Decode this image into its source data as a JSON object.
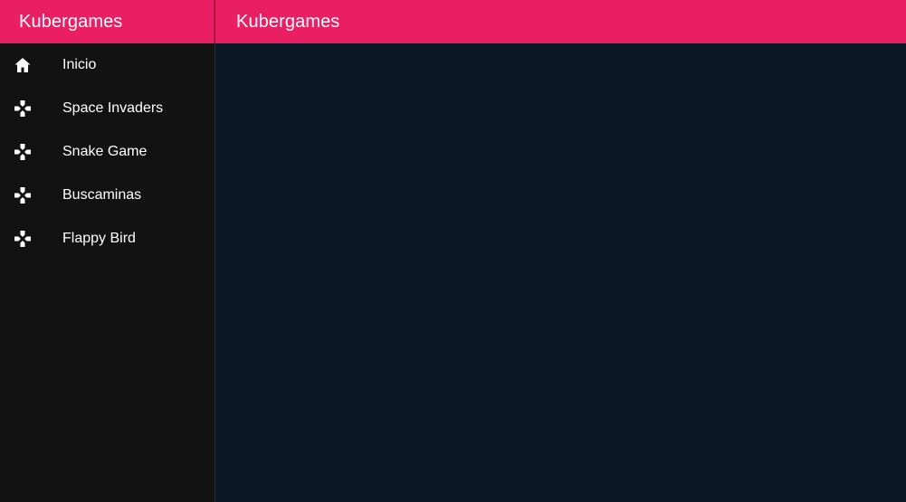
{
  "app": {
    "colors": {
      "accent": "#e91e63",
      "sidebar_bg": "#121212",
      "content_bg": "#0b1828",
      "text": "#ffffff"
    }
  },
  "sidebar": {
    "title": "Kubergames",
    "items": [
      {
        "label": "Inicio",
        "icon": "home-icon"
      },
      {
        "label": "Space Invaders",
        "icon": "gamepad-icon"
      },
      {
        "label": "Snake Game",
        "icon": "gamepad-icon"
      },
      {
        "label": "Buscaminas",
        "icon": "gamepad-icon"
      },
      {
        "label": "Flappy Bird",
        "icon": "gamepad-icon"
      }
    ]
  },
  "topbar": {
    "title": "Kubergames"
  }
}
